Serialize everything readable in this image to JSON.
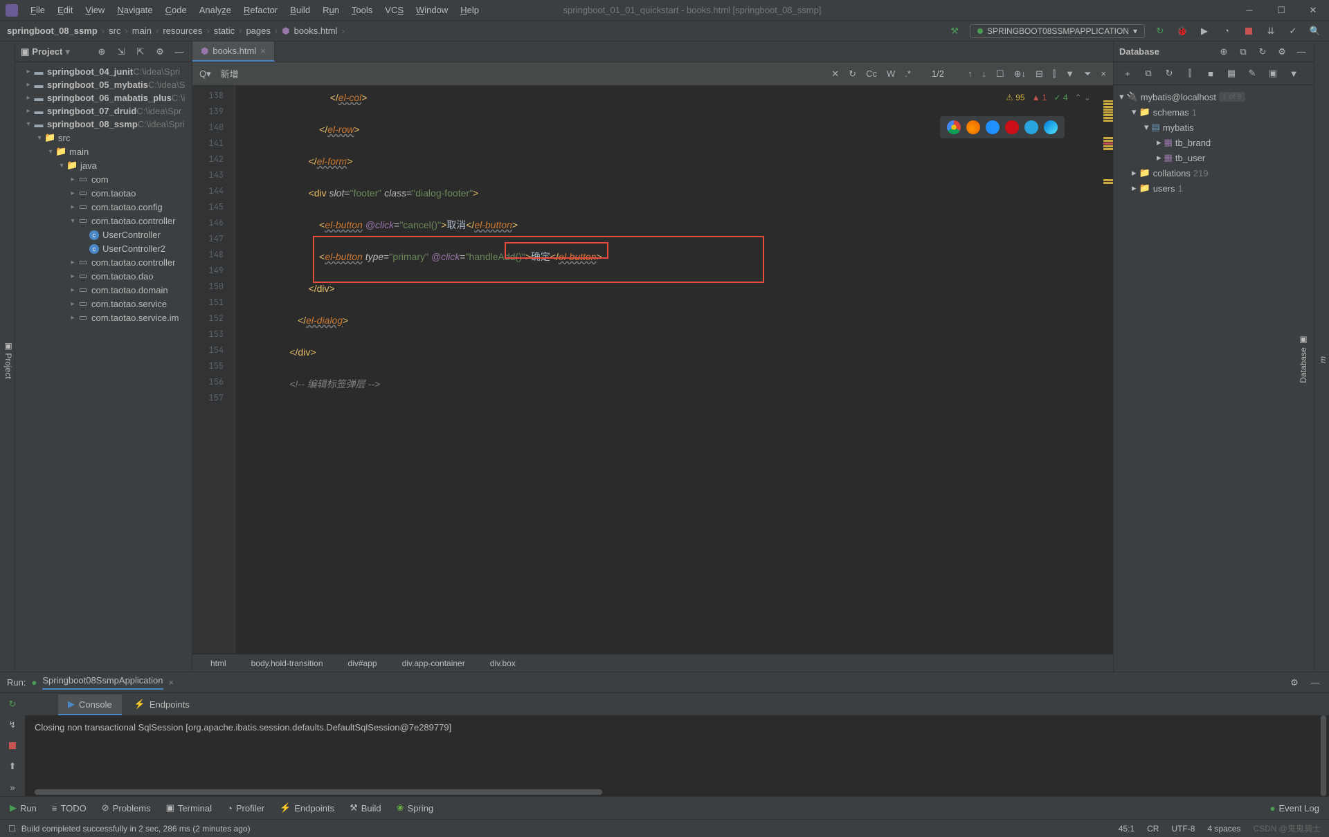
{
  "titlebar": {
    "title": "springboot_01_01_quickstart - books.html [springboot_08_ssmp]",
    "menus": [
      "File",
      "Edit",
      "View",
      "Navigate",
      "Code",
      "Analyze",
      "Refactor",
      "Build",
      "Run",
      "Tools",
      "VCS",
      "Window",
      "Help"
    ]
  },
  "breadcrumb": {
    "items": [
      "springboot_08_ssmp",
      "src",
      "main",
      "resources",
      "static",
      "pages",
      "books.html"
    ]
  },
  "run_config": "SPRINGBOOT08SSMPAPPLICATION",
  "project_panel": {
    "title": "Project",
    "tree": [
      {
        "indent": 0,
        "arrow": "▸",
        "icon": "folder",
        "label": "springboot_04_junit",
        "suffix": "C:\\idea\\Spri"
      },
      {
        "indent": 0,
        "arrow": "▸",
        "icon": "folder",
        "label": "springboot_05_mybatis",
        "suffix": "C:\\idea\\S"
      },
      {
        "indent": 0,
        "arrow": "▸",
        "icon": "folder",
        "label": "springboot_06_mabatis_plus",
        "suffix": "C:\\i"
      },
      {
        "indent": 0,
        "arrow": "▸",
        "icon": "folder",
        "label": "springboot_07_druid",
        "suffix": "C:\\idea\\Spr"
      },
      {
        "indent": 0,
        "arrow": "▾",
        "icon": "folder",
        "label": "springboot_08_ssmp",
        "suffix": "C:\\idea\\Spri"
      },
      {
        "indent": 1,
        "arrow": "▾",
        "icon": "dir",
        "label": "src",
        "suffix": ""
      },
      {
        "indent": 2,
        "arrow": "▾",
        "icon": "dir",
        "label": "main",
        "suffix": ""
      },
      {
        "indent": 3,
        "arrow": "▾",
        "icon": "dir",
        "label": "java",
        "suffix": ""
      },
      {
        "indent": 4,
        "arrow": "▸",
        "icon": "pkg",
        "label": "com",
        "suffix": ""
      },
      {
        "indent": 4,
        "arrow": "▸",
        "icon": "pkg",
        "label": "com.taotao",
        "suffix": ""
      },
      {
        "indent": 4,
        "arrow": "▸",
        "icon": "pkg",
        "label": "com.taotao.config",
        "suffix": ""
      },
      {
        "indent": 4,
        "arrow": "▾",
        "icon": "pkg",
        "label": "com.taotao.controller",
        "suffix": ""
      },
      {
        "indent": 5,
        "arrow": "",
        "icon": "class",
        "label": "UserController",
        "suffix": ""
      },
      {
        "indent": 5,
        "arrow": "",
        "icon": "class",
        "label": "UserController2",
        "suffix": ""
      },
      {
        "indent": 4,
        "arrow": "▸",
        "icon": "pkg",
        "label": "com.taotao.controller",
        "suffix": ""
      },
      {
        "indent": 4,
        "arrow": "▸",
        "icon": "pkg",
        "label": "com.taotao.dao",
        "suffix": ""
      },
      {
        "indent": 4,
        "arrow": "▸",
        "icon": "pkg",
        "label": "com.taotao.domain",
        "suffix": ""
      },
      {
        "indent": 4,
        "arrow": "▸",
        "icon": "pkg",
        "label": "com.taotao.service",
        "suffix": ""
      },
      {
        "indent": 4,
        "arrow": "▸",
        "icon": "pkg",
        "label": "com.taotao.service.im",
        "suffix": ""
      }
    ]
  },
  "editor": {
    "tab_name": "books.html",
    "search_value": "新增",
    "search_count": "1/2",
    "line_start": 138,
    "line_end": 157,
    "issues_warn": "95",
    "issues_err": "1",
    "issues_typo": "4",
    "breadcrumb": [
      "html",
      "body.hold-transition",
      "div#app",
      "div.app-container",
      "div.box"
    ]
  },
  "database": {
    "title": "Database",
    "connection": "mybatis@localhost",
    "conn_count": "1 of 9",
    "schemas_label": "schemas",
    "schemas_count": "1",
    "db_name": "mybatis",
    "tables": [
      "tb_brand",
      "tb_user"
    ],
    "collations_label": "collations",
    "collations_count": "219",
    "users_label": "users",
    "users_count": "1"
  },
  "run_panel": {
    "label": "Run:",
    "app_name": "Springboot08SsmpApplication",
    "tabs": [
      "Console",
      "Endpoints"
    ],
    "output": "Closing non transactional SqlSession [org.apache.ibatis.session.defaults.DefaultSqlSession@7e289779]"
  },
  "tool_windows": {
    "items": [
      "Run",
      "TODO",
      "Problems",
      "Terminal",
      "Profiler",
      "Endpoints",
      "Build",
      "Spring"
    ],
    "event_log": "Event Log"
  },
  "status_bar": {
    "message": "Build completed successfully in 2 sec, 286 ms (2 minutes ago)",
    "position": "45:1",
    "line_sep": "CR",
    "encoding": "UTF-8",
    "indent": "4 spaces",
    "watermark": "CSDN @鬼鬼骑士"
  }
}
